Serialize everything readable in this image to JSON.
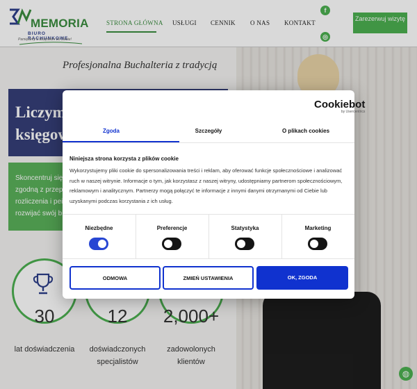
{
  "header": {
    "logo": {
      "name": "MEMORIA",
      "sub": "BIURO RACHUNKOWE",
      "tagline": "Pamiętamy o wszystkim za Ciebie!"
    },
    "nav": [
      {
        "label": "STRONA GŁÓWNA",
        "active": true
      },
      {
        "label": "USŁUGI",
        "active": false
      },
      {
        "label": "CENNIK",
        "active": false
      },
      {
        "label": "O NAS",
        "active": false
      },
      {
        "label": "KONTAKT",
        "active": false
      }
    ],
    "social": {
      "facebook_icon": "f",
      "instagram_icon": "◎"
    },
    "cta": "Zarezerwuj wizytę"
  },
  "hero": {
    "tagline": "Profesjonalna Buchalteria z tradycją",
    "heading": "Liczymy\nksięgow",
    "text": "Skoncentruj się\nzgodną z przepi\nrozliczenia i pein\nrozwijać swój bi"
  },
  "stats": [
    {
      "value": "30",
      "label": "lat doświadczenia",
      "icon": "trophy-icon"
    },
    {
      "value": "12",
      "label": "doświadczonych\nspecjalistów",
      "icon": ""
    },
    {
      "value": "2,000+",
      "label": "zadowolonych\nklientów",
      "icon": ""
    }
  ],
  "cookie_dialog": {
    "brand": "Cookiebot",
    "brand_sub": "by Usercentrics",
    "tabs": [
      "Zgoda",
      "Szczegóły",
      "O plikach cookies"
    ],
    "active_tab": "Zgoda",
    "title": "Niniejsza strona korzysta z plików cookie",
    "text": "Wykorzystujemy pliki cookie do spersonalizowania treści i reklam, aby oferować funkcje społecznościowe i analizować ruch w naszej witrynie. Informacje o tym, jak korzystasz z naszej witryny, udostępniamy partnerom społecznościowym, reklamowym i analitycznym. Partnerzy mogą połączyć te informacje z innymi danymi otrzymanymi od Ciebie lub uzyskanymi podczas korzystania z ich usług.",
    "toggles": [
      {
        "label": "Niezbędne",
        "on": true
      },
      {
        "label": "Preferencje",
        "on": false
      },
      {
        "label": "Statystyka",
        "on": false
      },
      {
        "label": "Marketing",
        "on": false
      }
    ],
    "buttons": {
      "deny": "ODMOWA",
      "customize": "ZMIEŃ USTAWIENIA",
      "accept": "OK, ZGODA"
    }
  },
  "colors": {
    "green": "#4caf50",
    "navy": "#353f78",
    "cookiebot_blue": "#1032cf"
  }
}
